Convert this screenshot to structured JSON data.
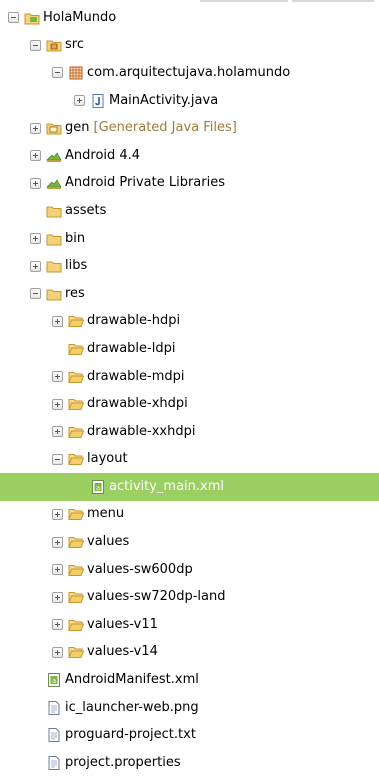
{
  "tree": [
    {
      "label": "HolaMundo",
      "icon": "android-project-icon",
      "toggle": "minus",
      "depth": 0
    },
    {
      "label": "src",
      "icon": "source-folder-icon",
      "toggle": "minus",
      "depth": 1
    },
    {
      "label": "com.arquitectujava.holamundo",
      "icon": "package-icon",
      "toggle": "minus",
      "depth": 2
    },
    {
      "label": "MainActivity.java",
      "icon": "java-file-icon",
      "toggle": "plus",
      "depth": 3
    },
    {
      "label": "gen",
      "decoration": "[Generated Java Files]",
      "icon": "generated-folder-icon",
      "toggle": "plus",
      "depth": 1
    },
    {
      "label": "Android 4.4",
      "icon": "library-icon",
      "toggle": "plus",
      "depth": 1
    },
    {
      "label": "Android Private Libraries",
      "icon": "library-icon",
      "toggle": "plus",
      "depth": 1
    },
    {
      "label": "assets",
      "icon": "folder-icon",
      "toggle": "none",
      "depth": 1
    },
    {
      "label": "bin",
      "icon": "folder-icon",
      "toggle": "plus",
      "depth": 1
    },
    {
      "label": "libs",
      "icon": "folder-icon",
      "toggle": "plus",
      "depth": 1
    },
    {
      "label": "res",
      "icon": "folder-icon",
      "toggle": "minus",
      "depth": 1
    },
    {
      "label": "drawable-hdpi",
      "icon": "open-folder-icon",
      "toggle": "plus",
      "depth": 2
    },
    {
      "label": "drawable-ldpi",
      "icon": "open-folder-icon",
      "toggle": "none",
      "depth": 2
    },
    {
      "label": "drawable-mdpi",
      "icon": "open-folder-icon",
      "toggle": "plus",
      "depth": 2
    },
    {
      "label": "drawable-xhdpi",
      "icon": "open-folder-icon",
      "toggle": "plus",
      "depth": 2
    },
    {
      "label": "drawable-xxhdpi",
      "icon": "open-folder-icon",
      "toggle": "plus",
      "depth": 2
    },
    {
      "label": "layout",
      "icon": "open-folder-icon",
      "toggle": "minus",
      "depth": 2
    },
    {
      "label": "activity_main.xml",
      "icon": "xml-file-icon",
      "toggle": "none",
      "depth": 3,
      "selected": true
    },
    {
      "label": "menu",
      "icon": "open-folder-icon",
      "toggle": "plus",
      "depth": 2
    },
    {
      "label": "values",
      "icon": "open-folder-icon",
      "toggle": "plus",
      "depth": 2
    },
    {
      "label": "values-sw600dp",
      "icon": "open-folder-icon",
      "toggle": "plus",
      "depth": 2
    },
    {
      "label": "values-sw720dp-land",
      "icon": "open-folder-icon",
      "toggle": "plus",
      "depth": 2
    },
    {
      "label": "values-v11",
      "icon": "open-folder-icon",
      "toggle": "plus",
      "depth": 2
    },
    {
      "label": "values-v14",
      "icon": "open-folder-icon",
      "toggle": "plus",
      "depth": 2
    },
    {
      "label": "AndroidManifest.xml",
      "icon": "xml-file-icon",
      "toggle": "none",
      "depth": 1
    },
    {
      "label": "ic_launcher-web.png",
      "icon": "file-icon",
      "toggle": "none",
      "depth": 1
    },
    {
      "label": "proguard-project.txt",
      "icon": "file-icon",
      "toggle": "none",
      "depth": 1
    },
    {
      "label": "project.properties",
      "icon": "file-icon",
      "toggle": "none",
      "depth": 1
    }
  ],
  "colors": {
    "selection": "#9bcf62",
    "decoration": "#a07a3c",
    "folder": "#e8b84a",
    "android_green": "#7cb342"
  }
}
